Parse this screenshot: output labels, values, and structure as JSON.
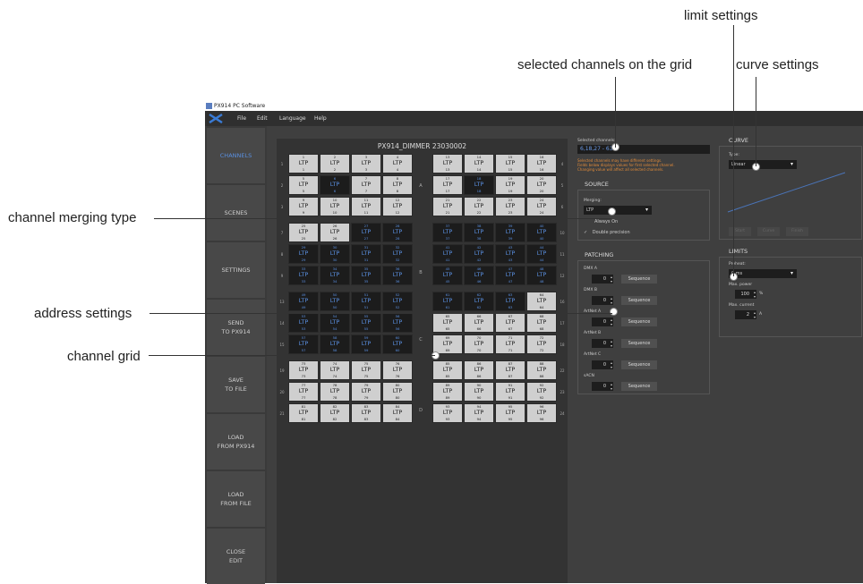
{
  "annotations": {
    "limit_settings": "limit settings",
    "selected_channels_on_grid": "selected channels on the grid",
    "curve_settings": "curve settings",
    "channel_merging_type": "channel merging type",
    "address_settings": "address settings",
    "channel_grid": "channel grid"
  },
  "window": {
    "title": "PX914 PC Software"
  },
  "menu": {
    "file": "File",
    "edit": "Edit",
    "language": "Language",
    "help": "Help"
  },
  "sidebar": {
    "items": [
      {
        "label": "CHANNELS"
      },
      {
        "label": "SCENES"
      },
      {
        "label": "SETTINGS"
      },
      {
        "label": "SEND\nTO PX914"
      },
      {
        "label": "SAVE\nTO FILE"
      },
      {
        "label": "LOAD\nFROM PX914"
      },
      {
        "label": "LOAD\nFROM FILE"
      },
      {
        "label": "CLOSE\nEDIT"
      }
    ]
  },
  "grid": {
    "title": "PX914_DIMMER 23030002",
    "cell_label": "LTP",
    "groups": [
      "A",
      "B",
      "C",
      "D"
    ],
    "rows": [
      {
        "left_num": "1",
        "right_num": "4",
        "left": [
          1,
          2,
          3,
          4
        ],
        "right": [
          13,
          14,
          15,
          16
        ],
        "dark": []
      },
      {
        "left_num": "2",
        "right_num": "5",
        "left": [
          5,
          6,
          7,
          8
        ],
        "right": [
          17,
          18,
          19,
          20
        ],
        "dark": [
          6,
          18
        ]
      },
      {
        "left_num": "3",
        "right_num": "6",
        "left": [
          9,
          10,
          11,
          12
        ],
        "right": [
          21,
          22,
          23,
          24
        ],
        "dark": []
      },
      {
        "left_num": "7",
        "right_num": "10",
        "left": [
          25,
          26,
          27,
          28
        ],
        "right": [
          37,
          38,
          39,
          40
        ],
        "dark": [
          27,
          28,
          37,
          38,
          39,
          40
        ]
      },
      {
        "left_num": "8",
        "right_num": "11",
        "left": [
          29,
          30,
          31,
          32
        ],
        "right": [
          41,
          42,
          43,
          44
        ],
        "dark": [
          29,
          30,
          31,
          32,
          41,
          42,
          43,
          44
        ]
      },
      {
        "left_num": "9",
        "right_num": "12",
        "left": [
          33,
          34,
          35,
          36
        ],
        "right": [
          45,
          46,
          47,
          48
        ],
        "dark": [
          33,
          34,
          35,
          36,
          45,
          46,
          47,
          48
        ]
      },
      {
        "left_num": "13",
        "right_num": "16",
        "left": [
          49,
          50,
          51,
          52
        ],
        "right": [
          61,
          62,
          63,
          64
        ],
        "dark": [
          49,
          50,
          51,
          52,
          61,
          62,
          63
        ]
      },
      {
        "left_num": "14",
        "right_num": "17",
        "left": [
          53,
          54,
          55,
          56
        ],
        "right": [
          65,
          66,
          67,
          68
        ],
        "dark": [
          53,
          54,
          55,
          56
        ]
      },
      {
        "left_num": "15",
        "right_num": "18",
        "left": [
          57,
          58,
          59,
          60
        ],
        "right": [
          69,
          70,
          71,
          72
        ],
        "dark": [
          57,
          58,
          59,
          60
        ]
      },
      {
        "left_num": "19",
        "right_num": "22",
        "left": [
          73,
          74,
          75,
          76
        ],
        "right": [
          85,
          86,
          87,
          88
        ],
        "dark": []
      },
      {
        "left_num": "20",
        "right_num": "23",
        "left": [
          77,
          78,
          79,
          80
        ],
        "right": [
          89,
          90,
          91,
          92
        ],
        "dark": []
      },
      {
        "left_num": "21",
        "right_num": "24",
        "left": [
          81,
          82,
          83,
          84
        ],
        "right": [
          93,
          94,
          95,
          96
        ],
        "dark": []
      }
    ]
  },
  "selected": {
    "label": "Selected channels:",
    "value": "6,18,27 - 63",
    "warning": [
      "Selected channels may have different settings.",
      "Fields below displays values for first selected channel.",
      "Changing value will affect all selected channels."
    ]
  },
  "source": {
    "header": "SOURCE",
    "merging_label": "Merging:",
    "merging_value": "LTP",
    "always_on": "Always On",
    "double_precision": "Double precision"
  },
  "patching": {
    "header": "PATCHING",
    "sequence_label": "Sequence",
    "items": [
      {
        "label": "DMX A",
        "value": "0"
      },
      {
        "label": "DMX B",
        "value": "0"
      },
      {
        "label": "ArtNet A",
        "value": "0"
      },
      {
        "label": "ArtNet B",
        "value": "0"
      },
      {
        "label": "ArtNet C",
        "value": "0"
      },
      {
        "label": "sACN",
        "value": "0"
      }
    ]
  },
  "curve": {
    "header": "CURVE",
    "type_label": "Type:",
    "type_value": "Linear",
    "buttons": [
      "Start",
      "Curve",
      "Finish"
    ]
  },
  "limits": {
    "header": "LIMITS",
    "preheat_label": "Preheat:",
    "preheat_value": "0 ms",
    "max_power_label": "Max. power",
    "max_power_value": "100",
    "max_power_unit": "%",
    "max_current_label": "Max. current",
    "max_current_value": "2",
    "max_current_unit": "A"
  },
  "colors": {
    "accent": "#5a8fe0",
    "warning": "#e08a3a",
    "background": "#3f3f3f"
  }
}
